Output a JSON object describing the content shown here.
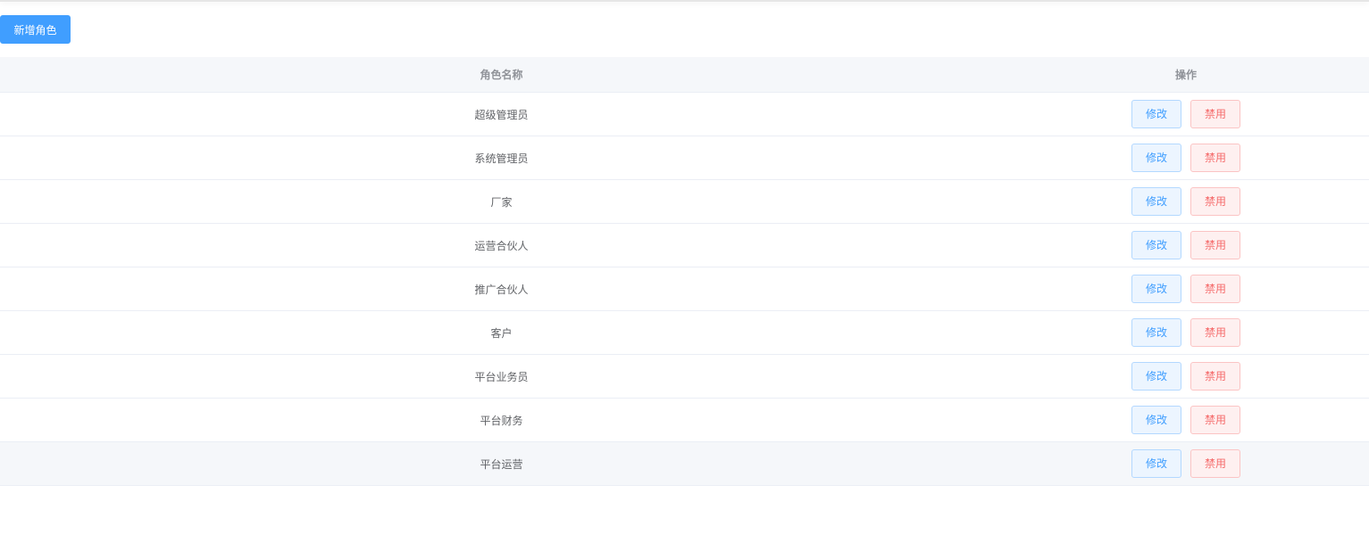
{
  "toolbar": {
    "add_role_label": "新增角色"
  },
  "table": {
    "columns": {
      "name": "角色名称",
      "ops": "操作"
    },
    "rows": [
      {
        "name": "超级管理员",
        "edit": "修改",
        "disable": "禁用"
      },
      {
        "name": "系统管理员",
        "edit": "修改",
        "disable": "禁用"
      },
      {
        "name": "厂家",
        "edit": "修改",
        "disable": "禁用"
      },
      {
        "name": "运营合伙人",
        "edit": "修改",
        "disable": "禁用"
      },
      {
        "name": "推广合伙人",
        "edit": "修改",
        "disable": "禁用"
      },
      {
        "name": "客户",
        "edit": "修改",
        "disable": "禁用"
      },
      {
        "name": "平台业务员",
        "edit": "修改",
        "disable": "禁用"
      },
      {
        "name": "平台财务",
        "edit": "修改",
        "disable": "禁用"
      },
      {
        "name": "平台运营",
        "edit": "修改",
        "disable": "禁用"
      }
    ],
    "hovered_row_index": 8
  },
  "colors": {
    "primary": "#409eff",
    "danger": "#f56c6c",
    "header_bg": "#f5f7fa"
  }
}
